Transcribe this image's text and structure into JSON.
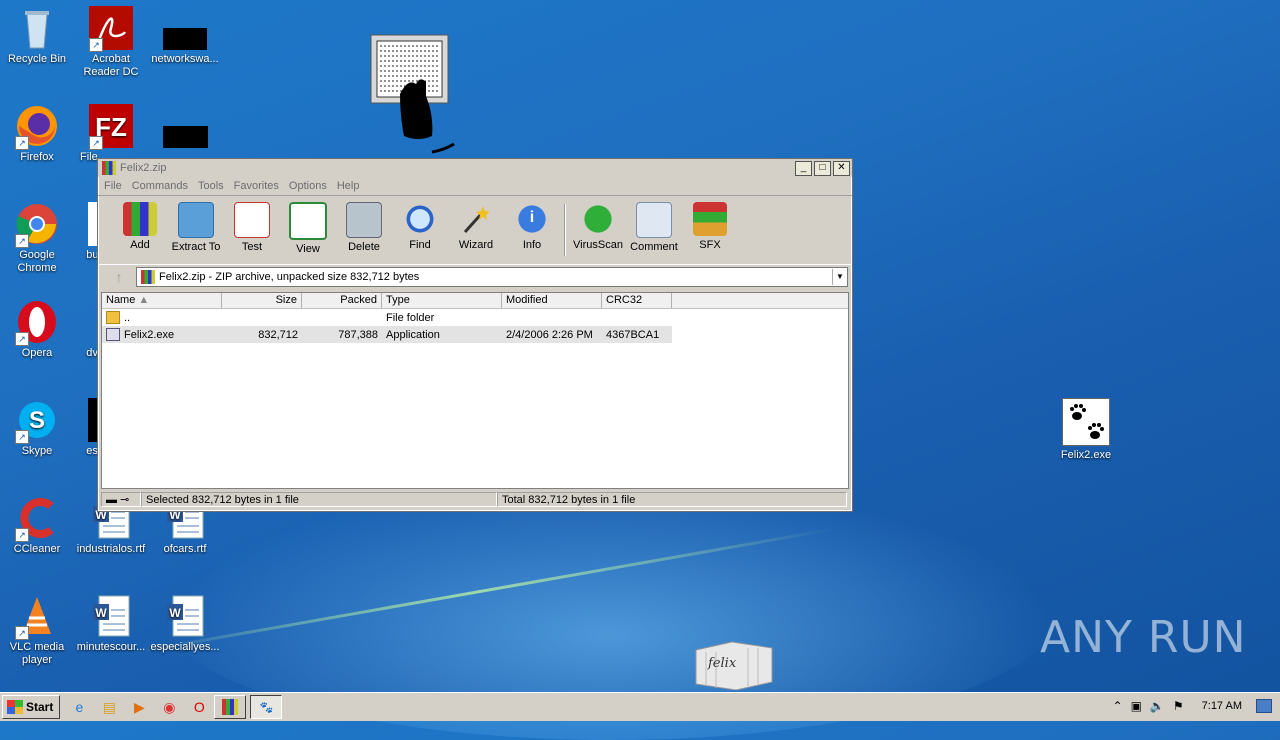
{
  "desktop": {
    "icons": [
      {
        "label": "Recycle Bin"
      },
      {
        "label": "Acrobat Reader DC"
      },
      {
        "label": "networkswa..."
      },
      {
        "label": "Firefox"
      },
      {
        "label": "File"
      },
      {
        "label": "Google Chrome"
      },
      {
        "label": "bus"
      },
      {
        "label": "Opera"
      },
      {
        "label": "dvd"
      },
      {
        "label": "Skype"
      },
      {
        "label": "esp"
      },
      {
        "label": "CCleaner"
      },
      {
        "label": "industrialos.rtf"
      },
      {
        "label": "ofcars.rtf"
      },
      {
        "label": "VLC media player"
      },
      {
        "label": "minutescour..."
      },
      {
        "label": "especiallyes..."
      },
      {
        "label": "Felix2.exe"
      }
    ],
    "watermark": "ANY RUN",
    "felix_box_text": "felix"
  },
  "window": {
    "title": "Felix2.zip",
    "menu": [
      "File",
      "Commands",
      "Tools",
      "Favorites",
      "Options",
      "Help"
    ],
    "toolbar": [
      "Add",
      "Extract To",
      "Test",
      "View",
      "Delete",
      "Find",
      "Wizard",
      "Info",
      "VirusScan",
      "Comment",
      "SFX"
    ],
    "address": "Felix2.zip - ZIP archive, unpacked size 832,712 bytes",
    "columns": [
      "Name",
      "Size",
      "Packed",
      "Type",
      "Modified",
      "CRC32"
    ],
    "rows": [
      {
        "name": "..",
        "size": "",
        "packed": "",
        "type": "File folder",
        "modified": "",
        "crc": ""
      },
      {
        "name": "Felix2.exe",
        "size": "832,712",
        "packed": "787,388",
        "type": "Application",
        "modified": "2/4/2006 2:26 PM",
        "crc": "4367BCA1"
      }
    ],
    "status_left": "Selected 832,712 bytes in 1 file",
    "status_right": "Total 832,712 bytes in 1 file"
  },
  "taskbar": {
    "start_label": "Start",
    "clock": "7:17 AM"
  },
  "colors": {
    "desktop": "#1a5fb0",
    "window_bg": "#d4d0c8",
    "selection": "#e3e3e3"
  }
}
